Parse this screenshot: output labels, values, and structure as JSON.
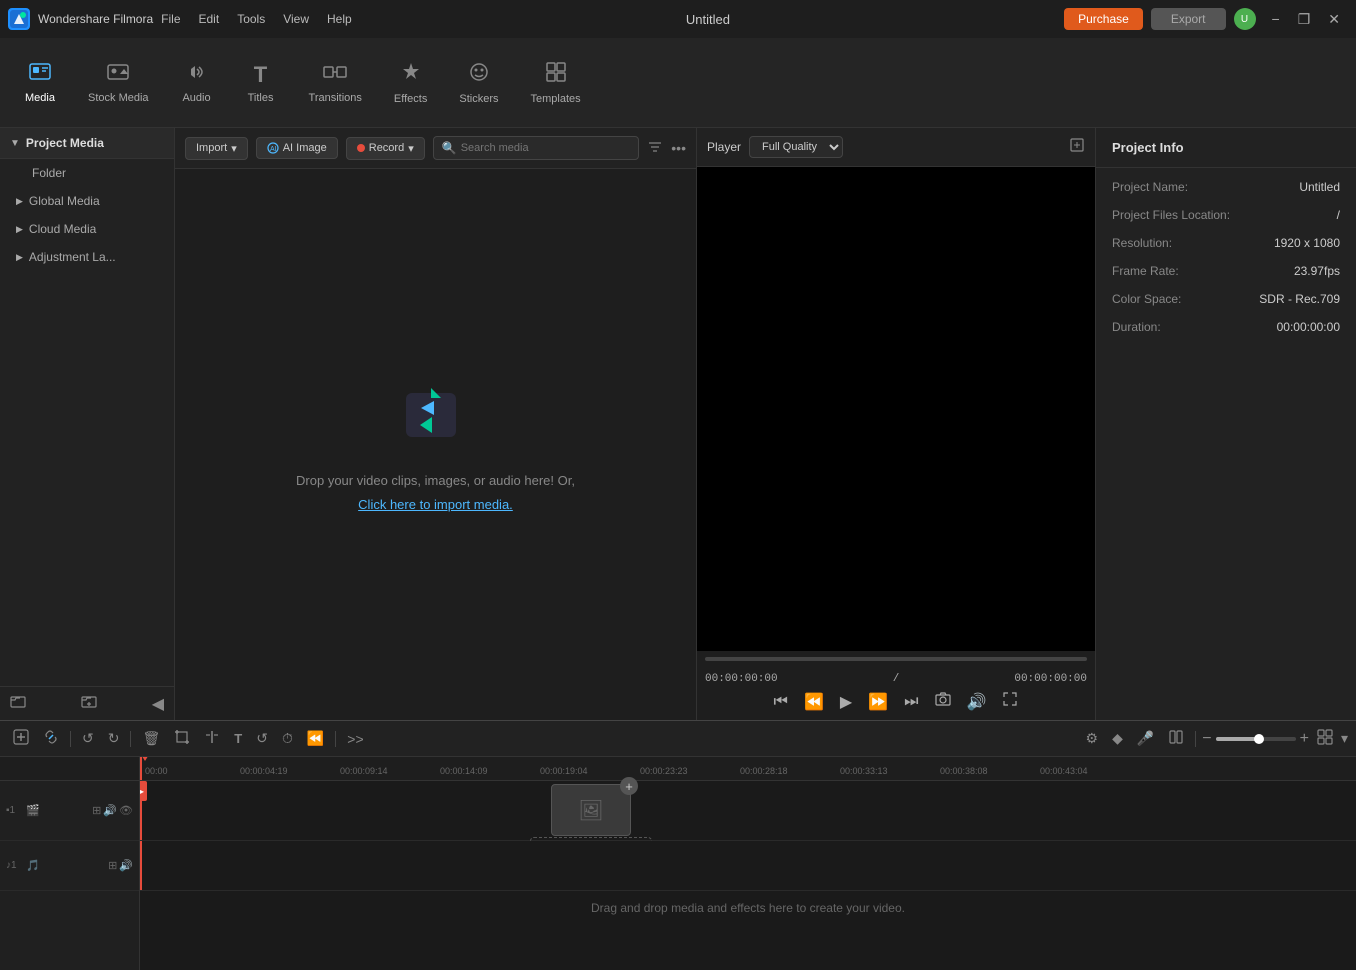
{
  "app": {
    "name": "Wondershare Filmora",
    "title": "Untitled",
    "logo": "WF"
  },
  "titlebar": {
    "menu": [
      "File",
      "Edit",
      "Tools",
      "View",
      "Help"
    ],
    "purchase_label": "Purchase",
    "export_label": "Export",
    "minimize": "−",
    "restore": "❐",
    "close": "✕"
  },
  "toolbar": {
    "items": [
      {
        "id": "media",
        "label": "Media",
        "icon": "🎞"
      },
      {
        "id": "stock",
        "label": "Stock Media",
        "icon": "🖼"
      },
      {
        "id": "audio",
        "label": "Audio",
        "icon": "🎵"
      },
      {
        "id": "titles",
        "label": "Titles",
        "icon": "T"
      },
      {
        "id": "transitions",
        "label": "Transitions",
        "icon": "⇄"
      },
      {
        "id": "effects",
        "label": "Effects",
        "icon": "✦"
      },
      {
        "id": "stickers",
        "label": "Stickers",
        "icon": "⭐"
      },
      {
        "id": "templates",
        "label": "Templates",
        "icon": "⊞"
      }
    ]
  },
  "left_panel": {
    "sections": [
      {
        "id": "project-media",
        "label": "Project Media",
        "active": true
      },
      {
        "id": "folder",
        "label": "Folder",
        "indent": true
      },
      {
        "id": "global-media",
        "label": "Global Media"
      },
      {
        "id": "cloud-media",
        "label": "Cloud Media"
      },
      {
        "id": "adjustment-la",
        "label": "Adjustment La..."
      }
    ]
  },
  "media_toolbar": {
    "import_label": "Import",
    "ai_image_label": "AI Image",
    "record_label": "Record",
    "search_placeholder": "Search media"
  },
  "drop_zone": {
    "text": "Drop your video clips, images, or audio here! Or,",
    "link_text": "Click here to import media."
  },
  "player": {
    "label": "Player",
    "quality": "Full Quality",
    "current_time": "00:00:00:00",
    "total_time": "00:00:00:00"
  },
  "project_info": {
    "tab_label": "Project Info",
    "fields": [
      {
        "label": "Project Name:",
        "value": "Untitled"
      },
      {
        "label": "Project Files Location:",
        "value": "/"
      },
      {
        "label": "Resolution:",
        "value": "1920 x 1080"
      },
      {
        "label": "Frame Rate:",
        "value": "23.97fps"
      },
      {
        "label": "Color Space:",
        "value": "SDR - Rec.709"
      },
      {
        "label": "Duration:",
        "value": "00:00:00:00"
      }
    ]
  },
  "timeline": {
    "ruler_marks": [
      "00:00",
      "00:00:04:19",
      "00:00:09:14",
      "00:00:14:09",
      "00:00:19:04",
      "00:00:23:23",
      "00:00:28:18",
      "00:00:33:13",
      "00:00:38:08",
      "00:00:43:04"
    ],
    "tracks": [
      {
        "num": "1",
        "type": "video",
        "icon": "🎬"
      },
      {
        "num": "1",
        "type": "audio",
        "icon": "🎵"
      }
    ],
    "drop_text": "Drag and drop media and effects here to create your video."
  }
}
